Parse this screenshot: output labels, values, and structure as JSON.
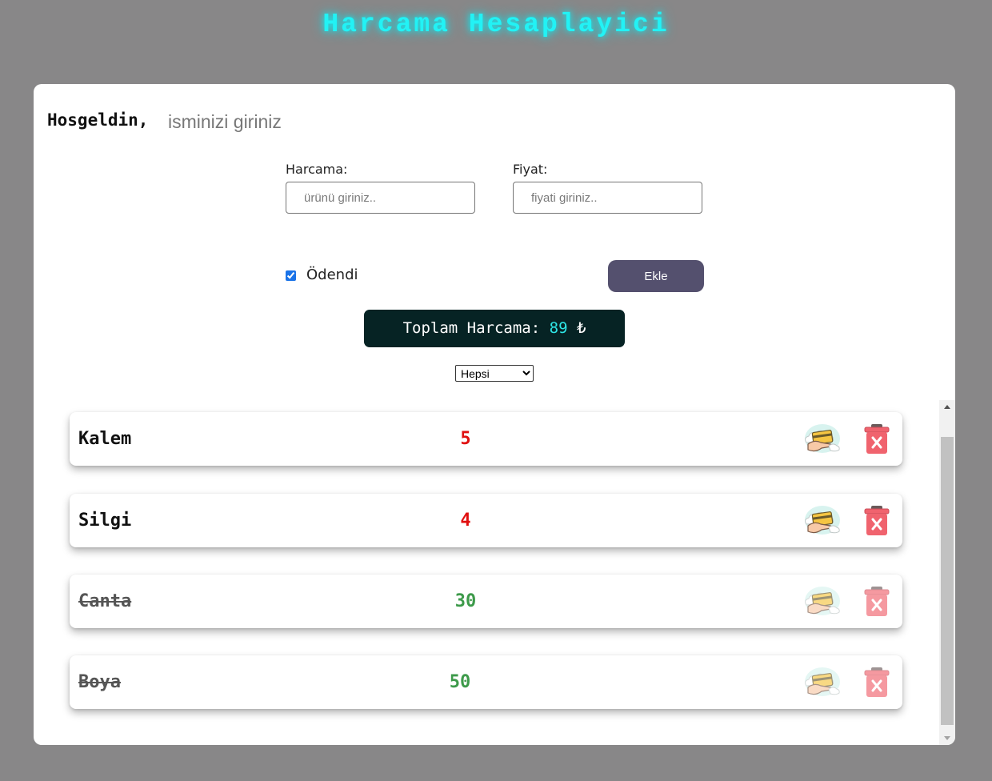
{
  "app": {
    "title": "Harcama Hesaplayici"
  },
  "welcome": {
    "label": "Hosgeldin,",
    "name_placeholder": "isminizi giriniz",
    "name_value": ""
  },
  "form": {
    "expense_label": "Harcama:",
    "expense_placeholder": "ürünü giriniz..",
    "expense_value": "",
    "price_label": "Fiyat:",
    "price_placeholder": "fiyati giriniz..",
    "price_value": "",
    "paid_label": "Ödendi",
    "paid_checked": true,
    "add_label": "Ekle"
  },
  "total": {
    "label": "Toplam Harcama:",
    "value": "89",
    "currency": "₺"
  },
  "filter": {
    "selected": "Hepsi",
    "options": [
      "Hepsi"
    ]
  },
  "items": [
    {
      "name": "Kalem",
      "price": "5",
      "paid": false
    },
    {
      "name": "Silgi",
      "price": "4",
      "paid": false
    },
    {
      "name": "Canta",
      "price": "30",
      "paid": true
    },
    {
      "name": "Boya",
      "price": "50",
      "paid": true
    }
  ],
  "colors": {
    "background": "#888788",
    "title_glow": "#22f2f5",
    "add_button": "#54506e",
    "total_box": "#062324",
    "total_value": "#2ee6e6",
    "unpaid_price": "#e01010",
    "paid_price": "#3d9a4a",
    "delete_icon": "#f0636e"
  },
  "icons": {
    "pay": "card-payment-icon",
    "delete": "trash-delete-icon"
  }
}
